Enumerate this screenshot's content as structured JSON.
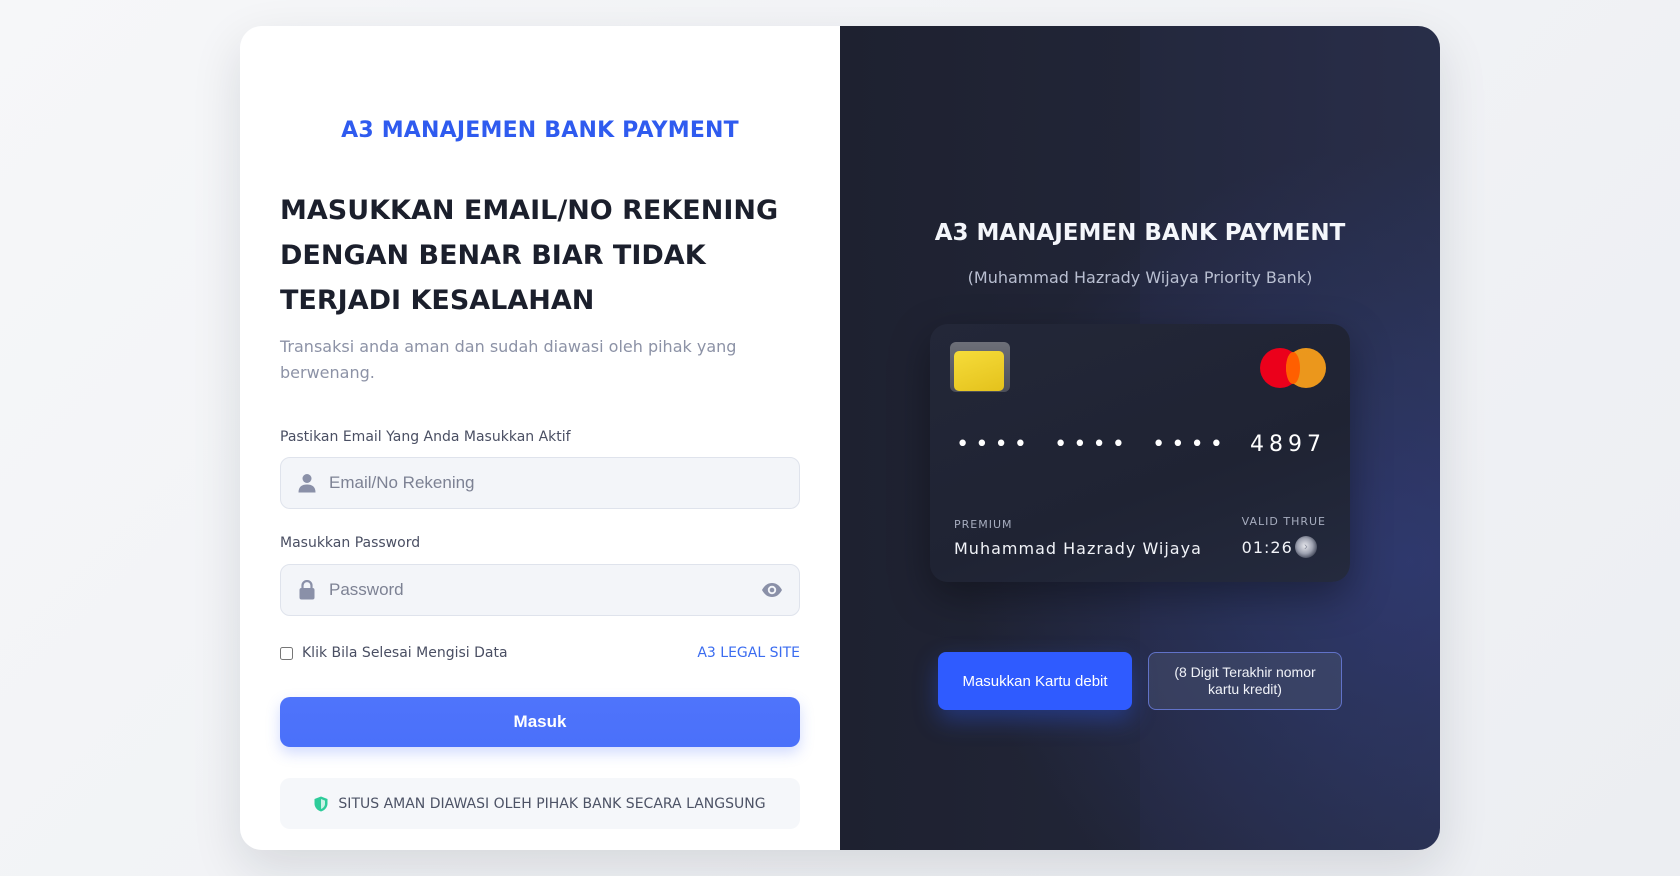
{
  "left": {
    "brand": "A3 MANAJEMEN BANK PAYMENT",
    "headline": "MASUKKAN EMAIL/NO REKENING DENGAN BENAR BIAR TIDAK TERJADI KESALAHAN",
    "subtitle": "Transaksi anda aman dan sudah diawasi oleh pihak yang berwenang.",
    "email_label": "Pastikan Email Yang Anda Masukkan Aktif",
    "email_placeholder": "Email/No Rekening",
    "email_value": "",
    "password_label": "Masukkan Password",
    "password_placeholder": "Password",
    "password_value": "",
    "checkbox_label": "Klik Bila Selesai Mengisi Data",
    "checkbox_checked": false,
    "legal_link": "A3 LEGAL SITE",
    "submit_label": "Masuk",
    "secure_note": "SITUS AMAN DIAWASI OLEH PIHAK BANK SECARA LANGSUNG",
    "icons": [
      "user-icon",
      "lock-icon",
      "eye-icon",
      "shield-check-icon"
    ]
  },
  "right": {
    "title": "A3 MANAJEMEN BANK PAYMENT",
    "subtitle": "(Muhammad Hazrady Wijaya Priority Bank)",
    "card": {
      "masked_groups": [
        "••••",
        "••••",
        "••••"
      ],
      "last_digits": "4897",
      "tier_label": "PREMIUM",
      "holder_name": "Muhammad Hazrady Wijaya",
      "valid_label": "VALID THRUE",
      "valid_value": "01:26",
      "icons": [
        "card-chip-icon",
        "mastercard-logo-icon"
      ]
    },
    "debit_button": "Masukkan Kartu debit",
    "credit_button": "(8 Digit Terakhir nomor kartu kredit)"
  },
  "colors": {
    "accent": "#2f5bef",
    "button": "#4a70fa",
    "dark_panel": "#212537",
    "secure_icon": "#2ecc9a"
  }
}
